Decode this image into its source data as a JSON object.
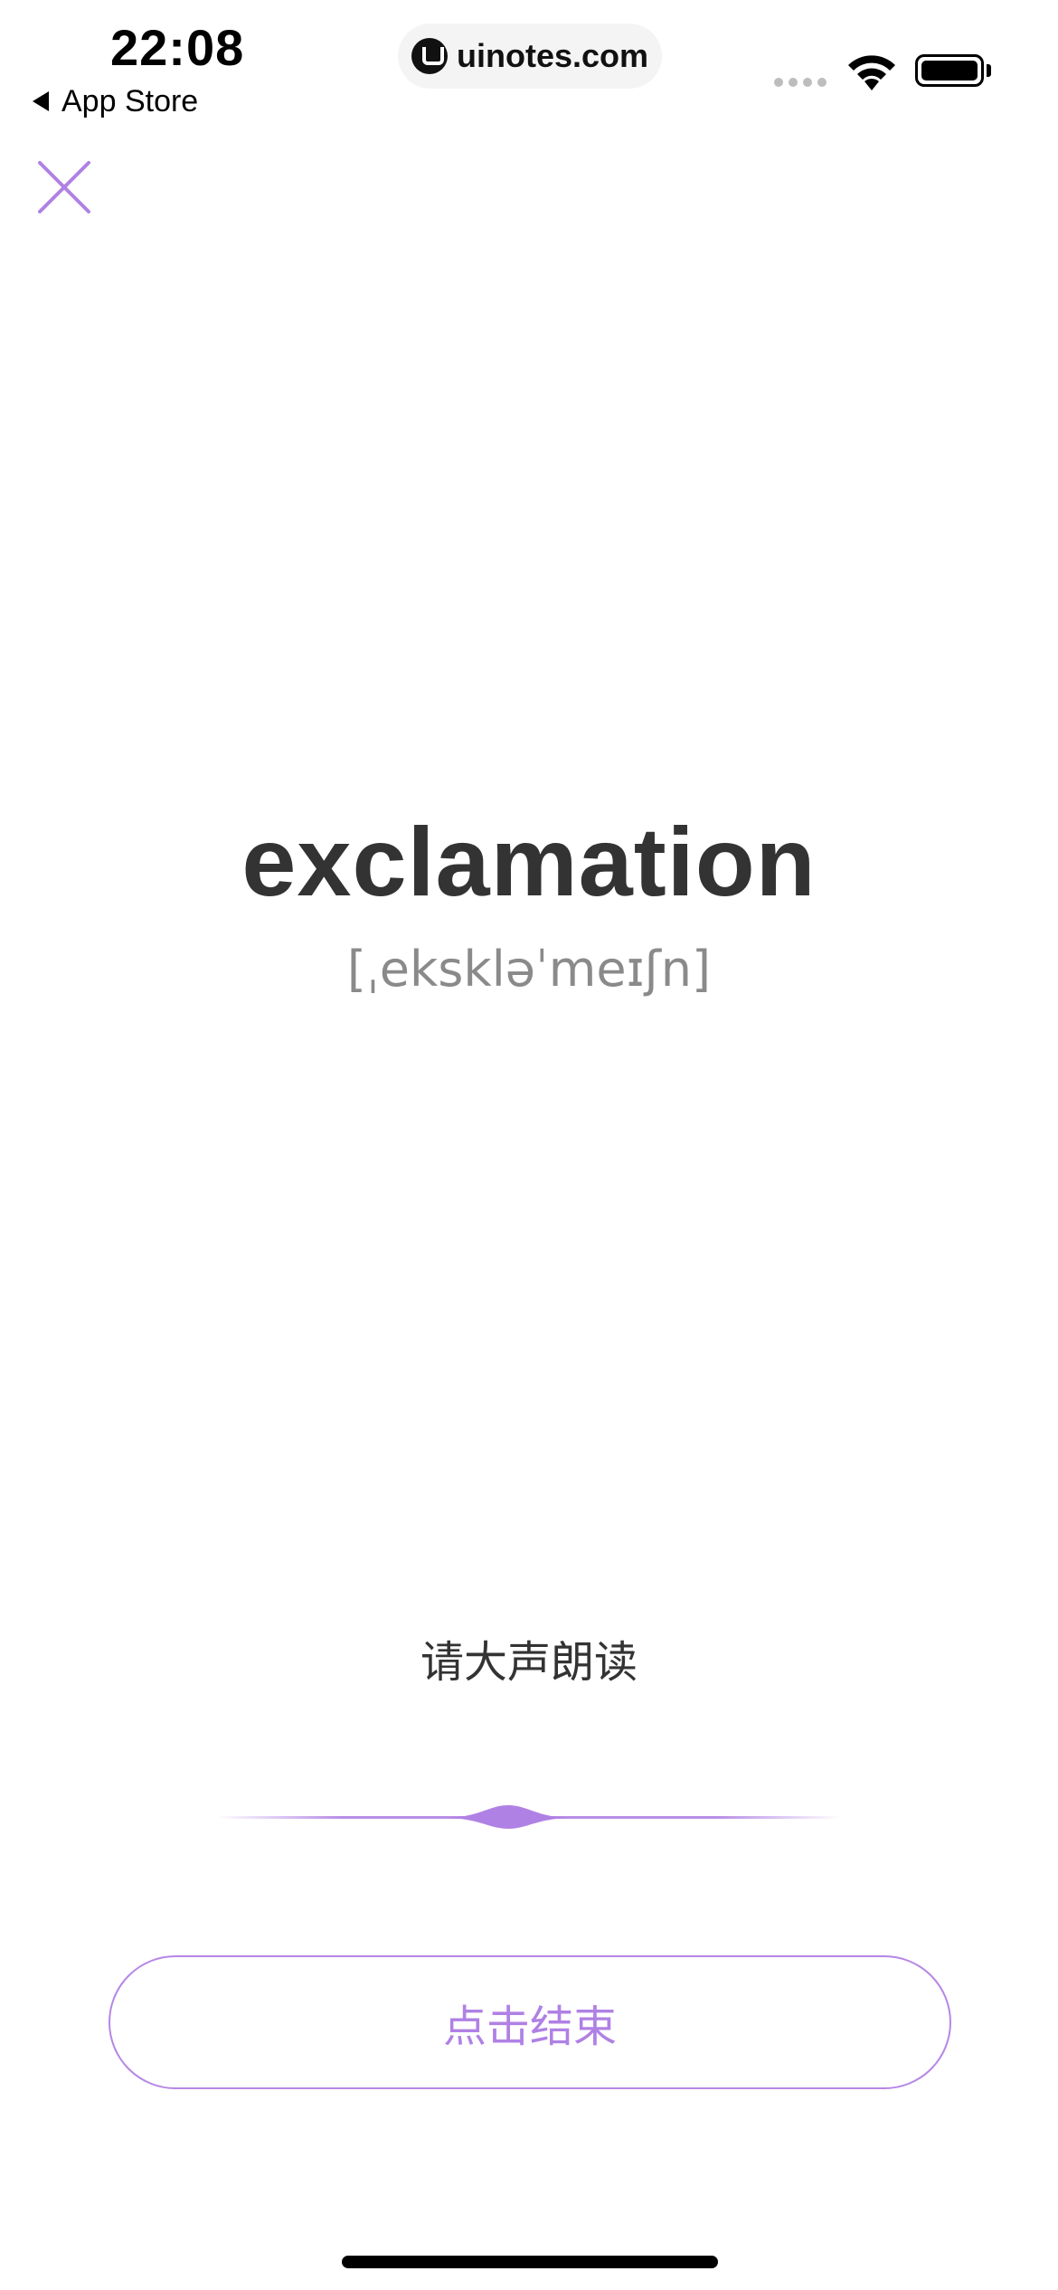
{
  "status_bar": {
    "time": "22:08",
    "back_label": "App Store",
    "url": "uinotes.com"
  },
  "word": {
    "text": "exclamation",
    "phonetic": "[ˌekskləˈmeɪʃn]"
  },
  "prompt": "请大声朗读",
  "button": {
    "label": "点击结束"
  },
  "colors": {
    "accent": "#b081e4",
    "word": "#333333",
    "phonetic": "#8a8a8a"
  }
}
